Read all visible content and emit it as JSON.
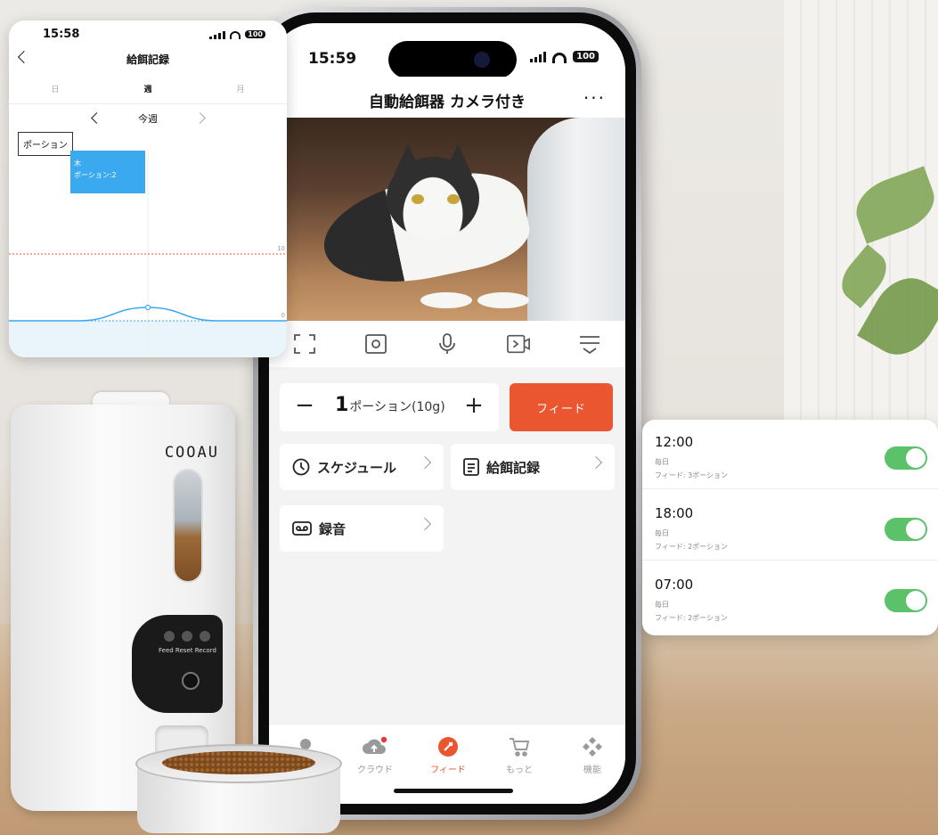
{
  "records_screen": {
    "time": "15:58",
    "battery": "100",
    "title": "給餌記録",
    "tabs": [
      {
        "label": "日",
        "active": false
      },
      {
        "label": "週",
        "active": true
      },
      {
        "label": "月",
        "active": false
      }
    ],
    "week_label": "今週",
    "legend": "ポーション",
    "tooltip": {
      "day": "木",
      "value": "ポーション:2"
    },
    "chart_data": {
      "type": "line",
      "series": [
        {
          "values": [
            0,
            0,
            2,
            0,
            0
          ]
        }
      ],
      "y_reference": [
        10,
        0
      ],
      "annotations": [
        "10",
        "0"
      ],
      "grid": false
    }
  },
  "phone": {
    "time": "15:59",
    "battery": "100",
    "app_title": "自動給餌器 カメラ付き",
    "more": "···",
    "camera_tools": [
      "fullscreen-icon",
      "snapshot-icon",
      "microphone-icon",
      "record-video-icon",
      "settings-menu-icon"
    ],
    "feed": {
      "minus": "−",
      "plus": "+",
      "quantity": "1",
      "unit": "ポーション(10g)",
      "button": "フィード"
    },
    "menu": {
      "schedule": "スケジュール",
      "records": "給餌記録",
      "recording": "録音"
    },
    "tabs": [
      {
        "label": "",
        "icon": "home-icon",
        "active": false
      },
      {
        "label": "クラウド",
        "icon": "cloud-icon",
        "active": false
      },
      {
        "label": "フィード",
        "icon": "feed-icon",
        "active": true
      },
      {
        "label": "もっと",
        "icon": "cart-icon",
        "active": false
      },
      {
        "label": "機能",
        "icon": "features-icon",
        "active": false
      }
    ]
  },
  "schedule": [
    {
      "time": "12:00",
      "repeat": "毎日",
      "detail": "フィード: 3ポーション",
      "enabled": true
    },
    {
      "time": "18:00",
      "repeat": "毎日",
      "detail": "フィード: 2ポーション",
      "enabled": true
    },
    {
      "time": "07:00",
      "repeat": "毎日",
      "detail": "フィード: 2ポーション",
      "enabled": true
    }
  ],
  "device": {
    "brand": "COOAU",
    "panel_labels": "Feed  Reset Record"
  },
  "colors": {
    "accent": "#e9562f",
    "toggle_on": "#5bc26a",
    "chart_line": "#3aa9ef",
    "reference_line": "#e9562f"
  }
}
